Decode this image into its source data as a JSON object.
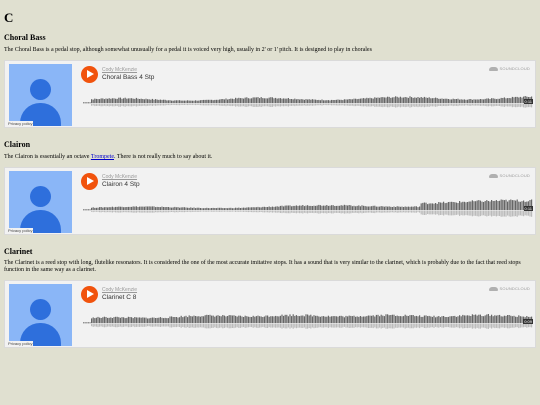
{
  "page_heading": "C",
  "sections": [
    {
      "title": "Choral Bass",
      "text": "The Choral Bass is a pedal stop, although somewhat unusually for a pedal it is voiced very high, usually in 2' or 1' pitch. It is designed to play in chorales",
      "player": {
        "uploader": "Cody McKenzie",
        "track": "Choral Bass 4 Stp",
        "logo": "SOUNDCLOUD",
        "privacy": "Privacy policy",
        "duration": "0:11"
      }
    },
    {
      "title": "Clairon",
      "text_before": "The Clairon is essentially an octave ",
      "link": "Trompete",
      "text_after": ". There is not really much to say about it.",
      "player": {
        "uploader": "Cody McKenzie",
        "track": "Clairon 4 Stp",
        "logo": "SOUNDCLOUD",
        "privacy": "Privacy policy",
        "duration": "0:11"
      }
    },
    {
      "title": "Clarinet",
      "text": "The Clarinet is a reed stop with long, flutelike resonators. It is considered the one of the most accurate imitative stops. It has a sound that is very similar to the clarinet, which is probably due to the fact that reed stops function in the same way as a clarinet.",
      "player": {
        "uploader": "Cody McKenzie",
        "track": "Clarinet C 8",
        "logo": "SOUNDCLOUD",
        "privacy": "Privacy policy",
        "duration": "0:09"
      }
    }
  ],
  "colors": {
    "background": "#e0e0d0",
    "play_button": "#f1530d",
    "avatar_bg": "#8ab6f7",
    "avatar_fg": "#2e6fdc",
    "wave": "#666666"
  }
}
